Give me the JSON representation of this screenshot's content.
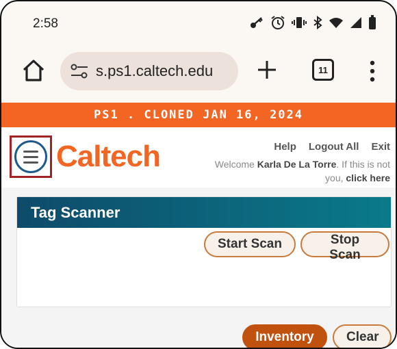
{
  "status_bar": {
    "time": "2:58",
    "icons": [
      "key-icon",
      "alarm-icon",
      "vibrate-icon",
      "bluetooth-icon",
      "wifi-icon",
      "signal-icon",
      "battery-icon"
    ]
  },
  "browser": {
    "url": "s.ps1.caltech.edu",
    "tab_count": "11"
  },
  "banner": {
    "text": "PS1 . CLONED JAN 16, 2024"
  },
  "header": {
    "logo": "Caltech",
    "links": {
      "help": "Help",
      "logout": "Logout All",
      "exit": "Exit"
    },
    "welcome_prefix": "Welcome ",
    "user_name": "Karla De La Torre",
    "welcome_suffix": ". If this is not you, ",
    "click_here": "click here"
  },
  "tag_scanner": {
    "title": "Tag Scanner",
    "start_label": "Start Scan",
    "stop_label": "Stop Scan"
  },
  "actions": {
    "inventory_label": "Inventory",
    "clear_label": "Clear"
  },
  "colors": {
    "accent_orange": "#f26522",
    "header_teal": "#0e4b6a",
    "inventory_button": "#c0510f",
    "highlight_red": "#a02323"
  }
}
